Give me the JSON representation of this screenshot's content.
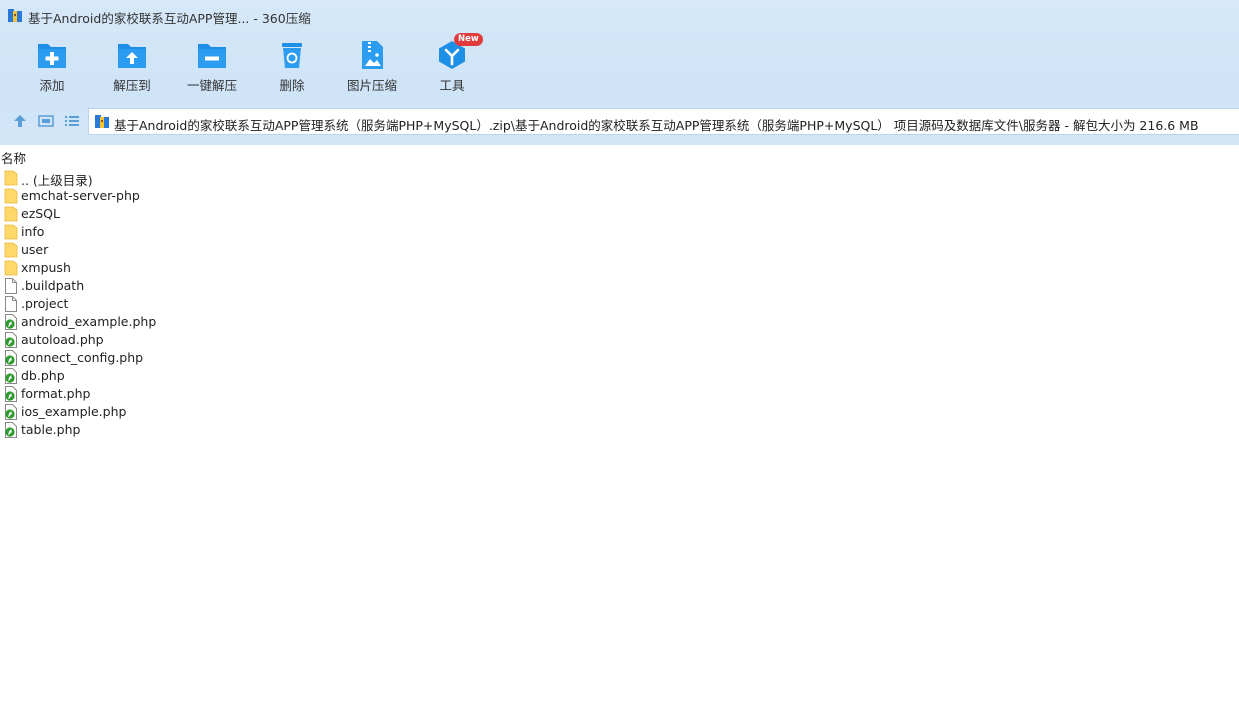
{
  "window": {
    "title": "基于Android的家校联系互动APP管理... - 360压缩"
  },
  "toolbar": {
    "add_label": "添加",
    "extract_to_label": "解压到",
    "one_click_extract_label": "一键解压",
    "delete_label": "删除",
    "image_compress_label": "图片压缩",
    "tools_label": "工具",
    "tools_badge": "New"
  },
  "address": {
    "path": "基于Android的家校联系互动APP管理系统（服务端PHP+MySQL）.zip\\基于Android的家校联系互动APP管理系统（服务端PHP+MySQL） 项目源码及数据库文件\\服务器 - 解包大小为 216.6 MB"
  },
  "columns": {
    "name": "名称"
  },
  "files": [
    {
      "name": ".. (上级目录)",
      "type": "folder"
    },
    {
      "name": "emchat-server-php",
      "type": "folder"
    },
    {
      "name": "ezSQL",
      "type": "folder"
    },
    {
      "name": "info",
      "type": "folder"
    },
    {
      "name": "user",
      "type": "folder"
    },
    {
      "name": "xmpush",
      "type": "folder"
    },
    {
      "name": ".buildpath",
      "type": "file"
    },
    {
      "name": ".project",
      "type": "file"
    },
    {
      "name": "android_example.php",
      "type": "php"
    },
    {
      "name": "autoload.php",
      "type": "php"
    },
    {
      "name": "connect_config.php",
      "type": "php"
    },
    {
      "name": "db.php",
      "type": "php"
    },
    {
      "name": "format.php",
      "type": "php"
    },
    {
      "name": "ios_example.php",
      "type": "php"
    },
    {
      "name": "table.php",
      "type": "php"
    }
  ],
  "colors": {
    "accent": "#1e8fe6",
    "badge": "#e23b3b",
    "folder": "#ffd86b"
  }
}
